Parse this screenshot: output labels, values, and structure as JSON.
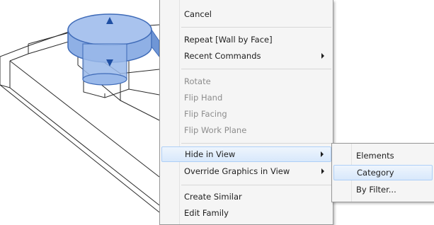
{
  "context_menu": {
    "items": [
      {
        "label": "Cancel"
      },
      {
        "label": "Repeat [Wall by Face]"
      },
      {
        "label": "Recent Commands"
      },
      {
        "label": "Rotate"
      },
      {
        "label": "Flip Hand"
      },
      {
        "label": "Flip Facing"
      },
      {
        "label": "Flip Work Plane"
      },
      {
        "label": "Hide in View"
      },
      {
        "label": "Override Graphics in View"
      },
      {
        "label": "Create Similar"
      },
      {
        "label": "Edit Family"
      }
    ]
  },
  "submenu": {
    "items": [
      {
        "label": "Elements"
      },
      {
        "label": "Category"
      },
      {
        "label": "By Filter..."
      }
    ]
  },
  "colors": {
    "menu_background": "#f5f5f5",
    "highlight": "#d8e8fb",
    "disabled_text": "#8d8d8d",
    "gizmo_blue": "#5b84c8"
  },
  "icons": [
    "arrow-up-icon",
    "arrow-down-icon",
    "submenu-arrow-icon"
  ]
}
